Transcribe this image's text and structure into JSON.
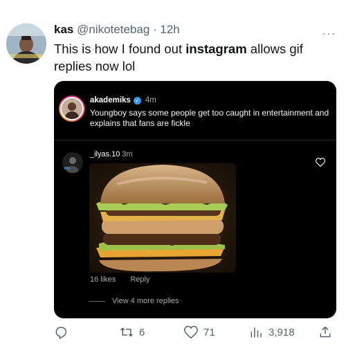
{
  "tweet": {
    "display_name": "kas",
    "handle": "@nikotetebag",
    "separator": " · ",
    "time": "12h",
    "more": "···",
    "text_before": "This is how I found out ",
    "text_bold": "instagram",
    "text_after": " allows gif replies now lol"
  },
  "post": {
    "username": "akademiks",
    "time": "4m",
    "caption": "Youngboy says some people get too caught in entertainment and explains that fans are fickle"
  },
  "comment": {
    "username": "_ilyas.10",
    "time": "3m",
    "likes": "16 likes",
    "reply": "Reply",
    "view_more": "View 4 more replies"
  },
  "actions": {
    "retweets": "6",
    "likes": "71",
    "views": "3,918"
  },
  "colors": {
    "accent_blue": "#3897f0",
    "meta_gray": "#536471"
  }
}
